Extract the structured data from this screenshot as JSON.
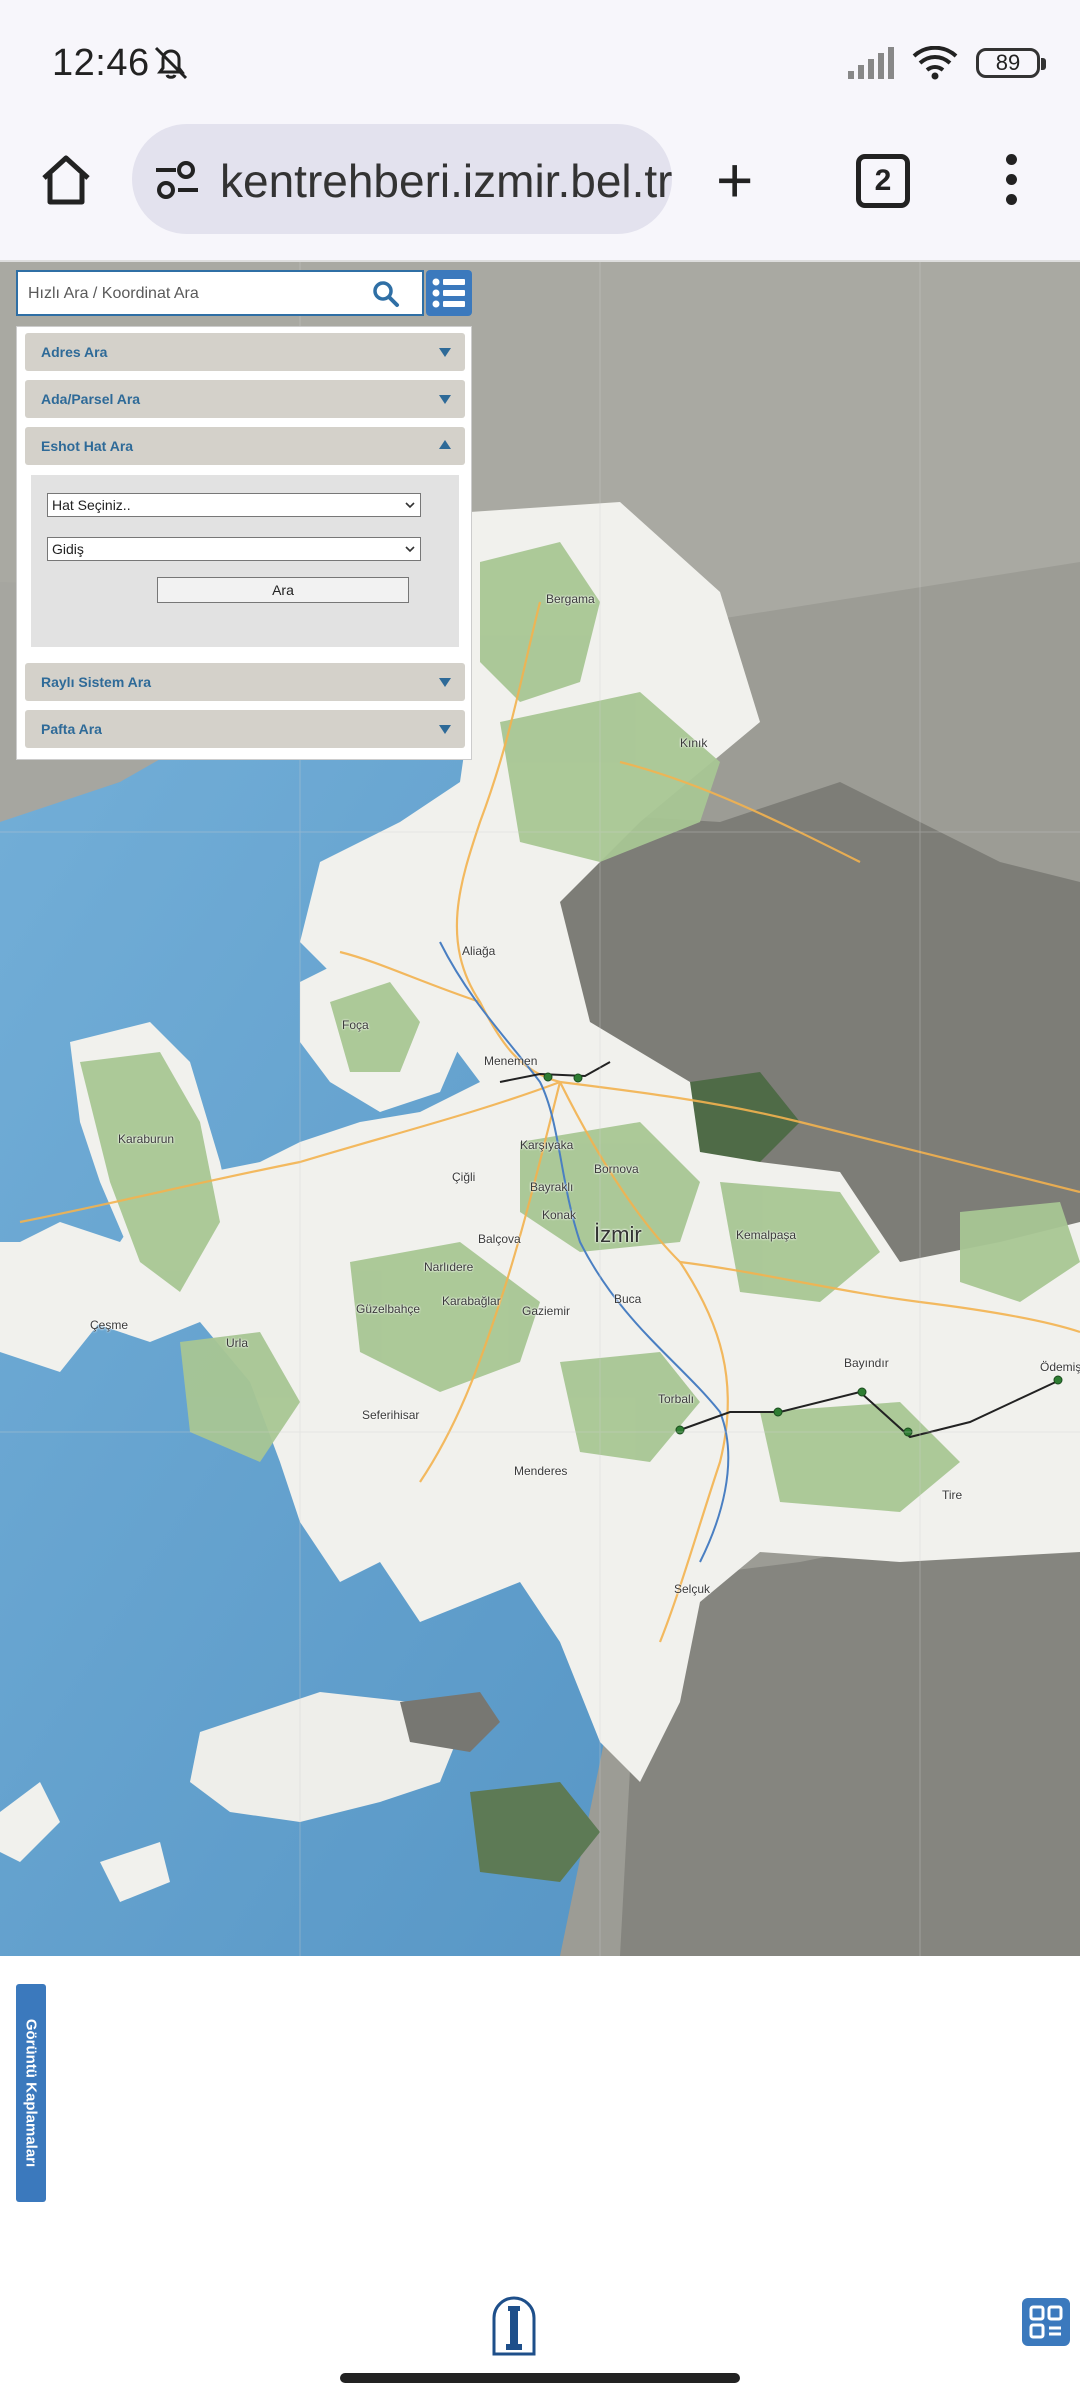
{
  "status_bar": {
    "time": "12:46",
    "battery": "89",
    "icons": [
      "bell-off-icon",
      "signal-icon",
      "wifi-icon",
      "battery-icon"
    ]
  },
  "browser": {
    "url": "kentrehberi.izmir.bel.tr",
    "tab_count": "2",
    "icons": [
      "home-icon",
      "site-settings-icon",
      "plus-icon",
      "tabs-icon",
      "more-vert-icon"
    ]
  },
  "search": {
    "placeholder": "Hızlı Ara / Koordinat Ara",
    "value": ""
  },
  "accordion": {
    "items": [
      {
        "label": "Adres Ara",
        "expanded": false
      },
      {
        "label": "Ada/Parsel Ara",
        "expanded": false
      },
      {
        "label": "Eshot Hat Ara",
        "expanded": true
      },
      {
        "label": "Raylı Sistem Ara",
        "expanded": false
      },
      {
        "label": "Pafta Ara",
        "expanded": false
      }
    ],
    "eshot": {
      "line_select": "Hat Seçiniz..",
      "direction_select": "Gidiş",
      "search_button": "Ara"
    }
  },
  "map": {
    "city_label": "İzmir",
    "places": [
      "Bergama",
      "Kınık",
      "Aliağa",
      "Foça",
      "Menemen",
      "Karaburun",
      "Karşıyaka",
      "Bornova",
      "Çiğli",
      "Bayraklı",
      "Balçova",
      "Konak",
      "Kemalpaşa",
      "Narlıdere",
      "Çeşme",
      "Güzelbahçe",
      "Karabağlar",
      "Gaziemir",
      "Buca",
      "Urla",
      "Bayındır",
      "Ödemiş",
      "Seferihisar",
      "Torbalı",
      "Menderes",
      "Tire",
      "Selçuk"
    ]
  },
  "bottom": {
    "side_tab_label": "Görüntü Kaplamaları",
    "icons": [
      "izmir-logo-icon",
      "grid-menu-icon"
    ]
  },
  "colors": {
    "accent": "#3b79bd",
    "accordion_header": "#d4d1ca",
    "accordion_label": "#2e6a98",
    "sea": "#5fa3d2",
    "land": "#f1f1ed",
    "vegetation": "#a8c694"
  }
}
